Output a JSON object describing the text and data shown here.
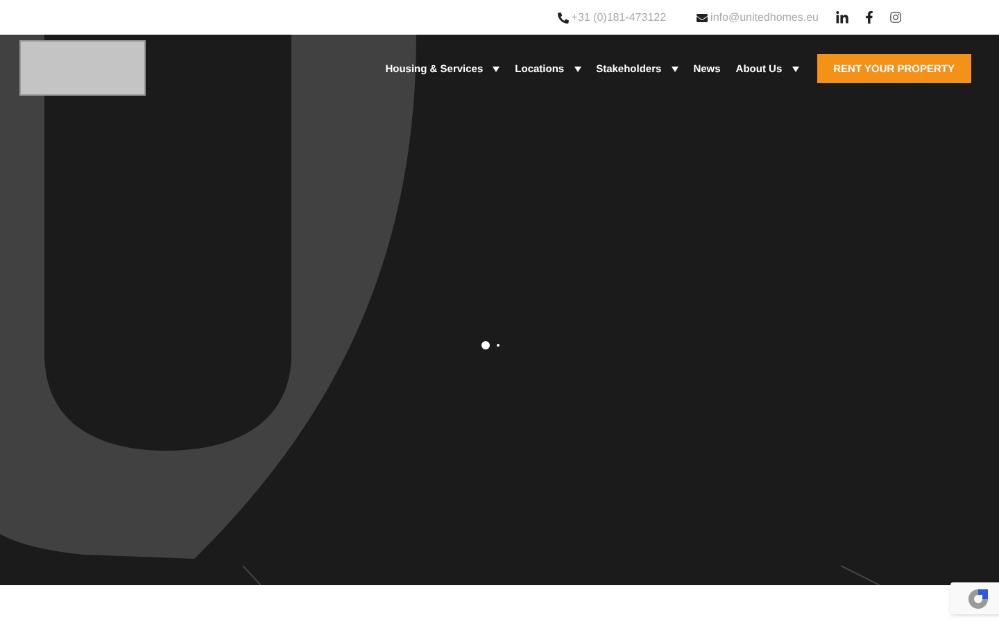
{
  "top_bar": {
    "phone": "+31 (0)181-473122",
    "email": "info@unitedhomes.eu",
    "social": [
      {
        "kind": "linkedin"
      },
      {
        "kind": "facebook"
      },
      {
        "kind": "instagram"
      }
    ]
  },
  "nav": {
    "items": [
      {
        "label": "Housing & Services",
        "has_dropdown": true
      },
      {
        "label": "Locations",
        "has_dropdown": true
      },
      {
        "label": "Stakeholders",
        "has_dropdown": true
      },
      {
        "label": "News",
        "has_dropdown": false
      },
      {
        "label": "About Us",
        "has_dropdown": true
      }
    ],
    "cta": "RENT YOUR PROPERTY"
  }
}
